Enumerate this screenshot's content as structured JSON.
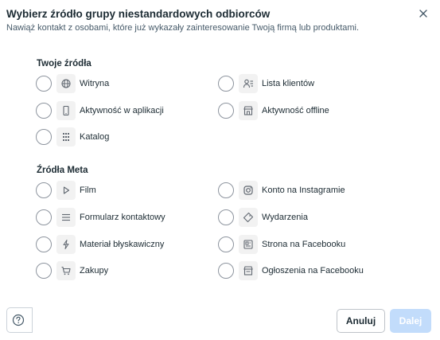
{
  "dialog": {
    "title": "Wybierz źródło grupy niestandardowych odbiorców",
    "subtitle": "Nawiąż kontakt z osobami, które już wykazały zainteresowanie Twoją firmą lub produktami."
  },
  "sections": {
    "own": {
      "title": "Twoje źródła",
      "options": [
        {
          "label": "Witryna",
          "icon": "globe-icon"
        },
        {
          "label": "Lista klientów",
          "icon": "customer-list-icon"
        },
        {
          "label": "Aktywność w aplikacji",
          "icon": "mobile-icon"
        },
        {
          "label": "Aktywność offline",
          "icon": "store-icon"
        },
        {
          "label": "Katalog",
          "icon": "grid-icon"
        }
      ]
    },
    "meta": {
      "title": "Źródła Meta",
      "options": [
        {
          "label": "Film",
          "icon": "play-icon"
        },
        {
          "label": "Konto na Instagramie",
          "icon": "instagram-icon"
        },
        {
          "label": "Formularz kontaktowy",
          "icon": "form-lines-icon"
        },
        {
          "label": "Wydarzenia",
          "icon": "ticket-icon"
        },
        {
          "label": "Materiał błyskawiczny",
          "icon": "lightning-icon"
        },
        {
          "label": "Strona na Facebooku",
          "icon": "facebook-page-icon"
        },
        {
          "label": "Zakupy",
          "icon": "cart-icon"
        },
        {
          "label": "Ogłoszenia na Facebooku",
          "icon": "marketplace-icon"
        }
      ]
    }
  },
  "footer": {
    "cancel_label": "Anuluj",
    "next_label": "Dalej"
  },
  "colors": {
    "primary_disabled": "#c2dcfb",
    "text": "#1c2b33",
    "border": "#bec3c9"
  }
}
